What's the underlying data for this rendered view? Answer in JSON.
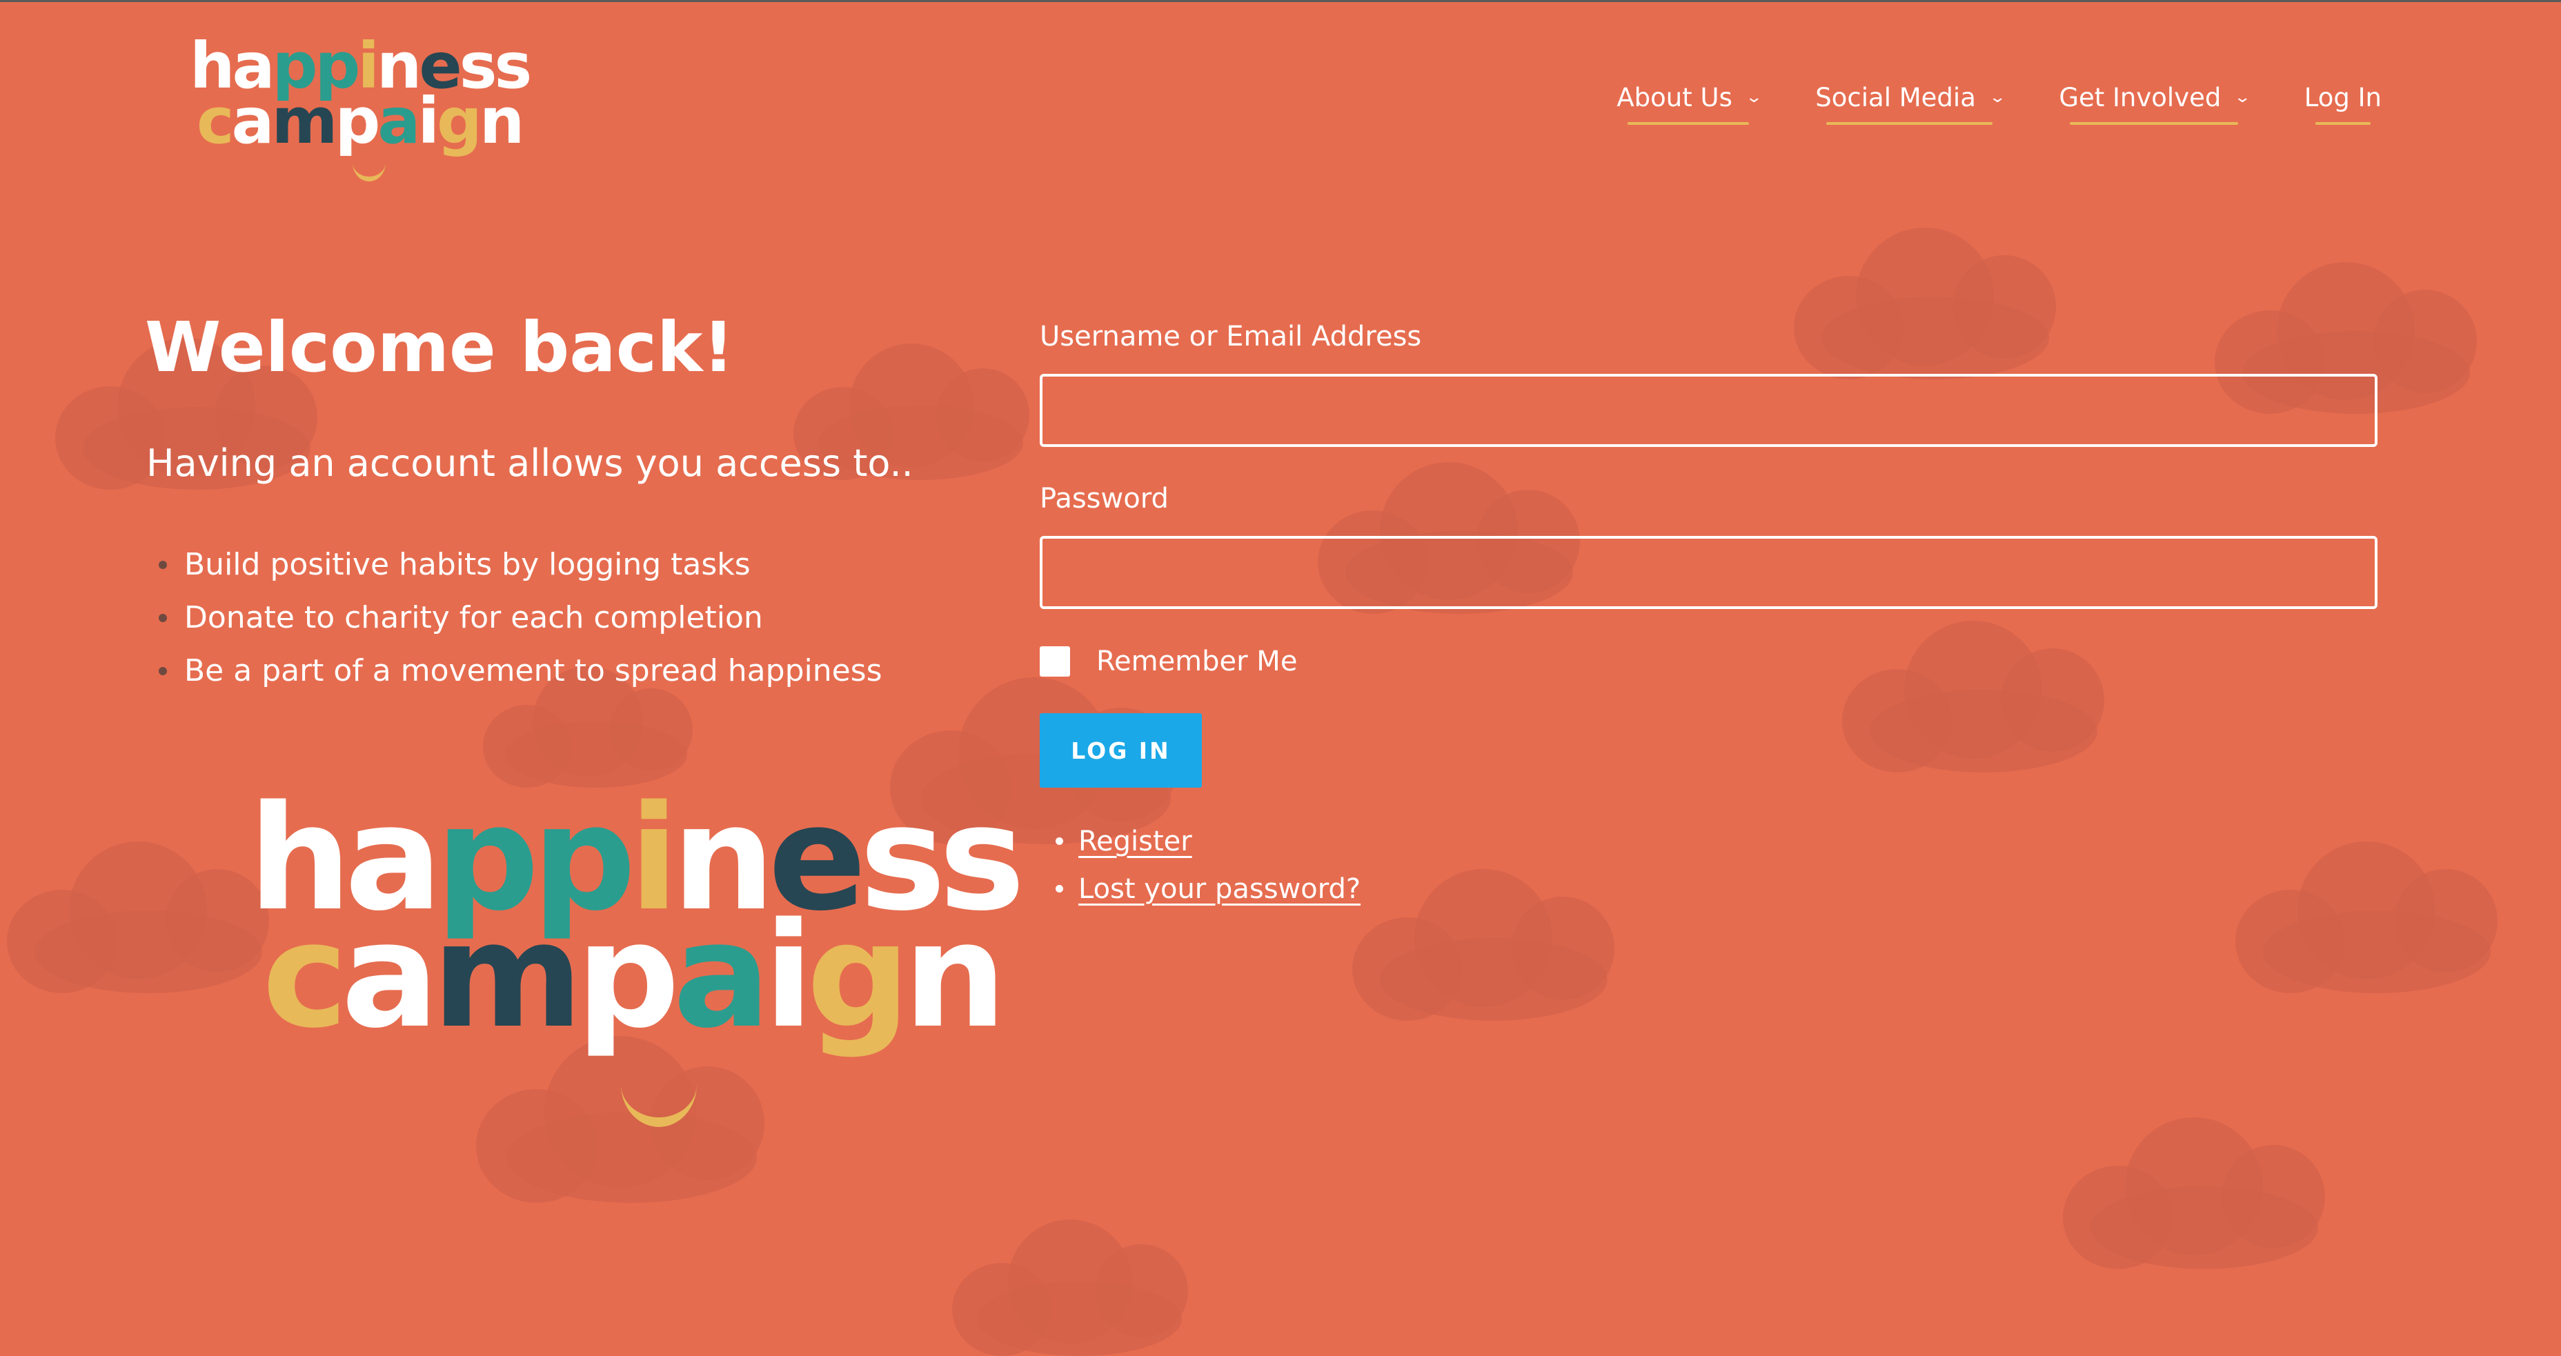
{
  "colors": {
    "background": "#e66c4f",
    "cloud": "#d3614a",
    "button": "#1ba8e8",
    "nav_underline": "#e8b958",
    "logo_yellow": "#e8b958",
    "logo_teal": "#2a9d8f",
    "logo_navy": "#264653",
    "logo_white": "#ffffff"
  },
  "logo": {
    "line1": "happiness",
    "line2": "campaign",
    "icon": "smiley-face-icon"
  },
  "nav": {
    "items": [
      {
        "label": "About Us",
        "has_dropdown": true,
        "icon": "chevron-down-icon"
      },
      {
        "label": "Social Media",
        "has_dropdown": true,
        "icon": "chevron-down-icon"
      },
      {
        "label": "Get Involved",
        "has_dropdown": true,
        "icon": "chevron-down-icon"
      },
      {
        "label": "Log In",
        "has_dropdown": false
      }
    ]
  },
  "intro": {
    "heading": "Welcome back!",
    "subtitle": "Having an account allows you access to..",
    "benefits": [
      "Build positive habits by logging tasks",
      "Donate to charity for each completion",
      "Be a part of a movement to spread happiness"
    ]
  },
  "form": {
    "username_label": "Username or Email Address",
    "username_value": "",
    "password_label": "Password",
    "password_value": "",
    "remember_label": "Remember Me",
    "remember_checked": false,
    "submit_label": "LOG IN",
    "links": [
      "Register",
      "Lost your password?"
    ]
  }
}
